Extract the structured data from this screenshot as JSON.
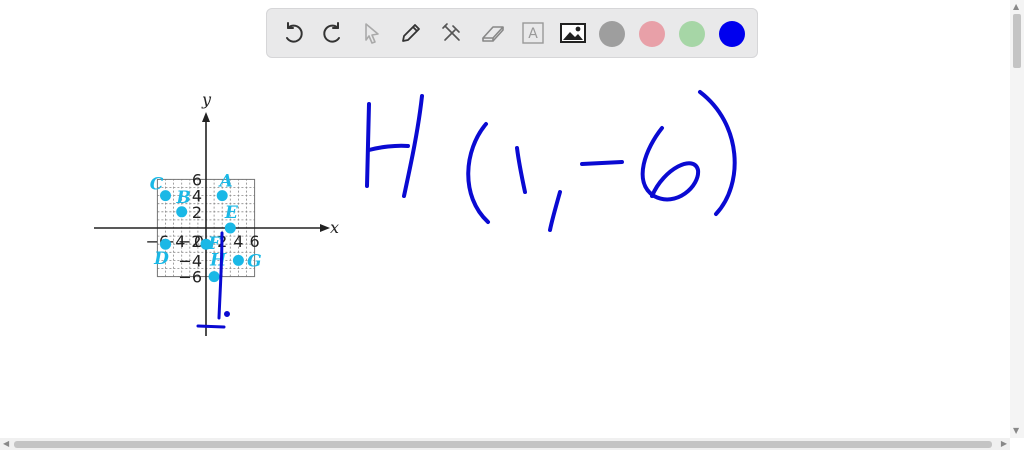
{
  "toolbar": {
    "tools": [
      "undo-icon",
      "redo-icon",
      "select-pointer-icon",
      "pen-icon",
      "tools-icon",
      "eraser-icon",
      "text-icon",
      "image-icon"
    ],
    "text_tool_label": "A",
    "colors": [
      "#9e9e9e",
      "#e8a0a8",
      "#a6d6a6",
      "#0000ee"
    ],
    "selected_color": "#0000ee"
  },
  "graph": {
    "x_axis_label": "x",
    "y_axis_label": "y",
    "x_tick_labels": [
      "−6",
      "−4",
      "−2",
      "0",
      "2",
      "4",
      "6"
    ],
    "y_tick_labels": [
      "6",
      "4",
      "2",
      "−4",
      "−6"
    ],
    "point_color": "#1ab8e6",
    "points": [
      {
        "label": "A",
        "x": 2,
        "y": 4
      },
      {
        "label": "B",
        "x": -3,
        "y": 2
      },
      {
        "label": "C",
        "x": -5,
        "y": 4
      },
      {
        "label": "D",
        "x": -5,
        "y": -2
      },
      {
        "label": "E",
        "x": 3,
        "y": 0
      },
      {
        "label": "F",
        "x": 0,
        "y": -2
      },
      {
        "label": "G",
        "x": 4,
        "y": -4
      },
      {
        "label": "H",
        "x": 1,
        "y": -6
      }
    ]
  },
  "handwriting": {
    "text": "H (1, -6)",
    "ink_color": "#0a0ad2"
  }
}
